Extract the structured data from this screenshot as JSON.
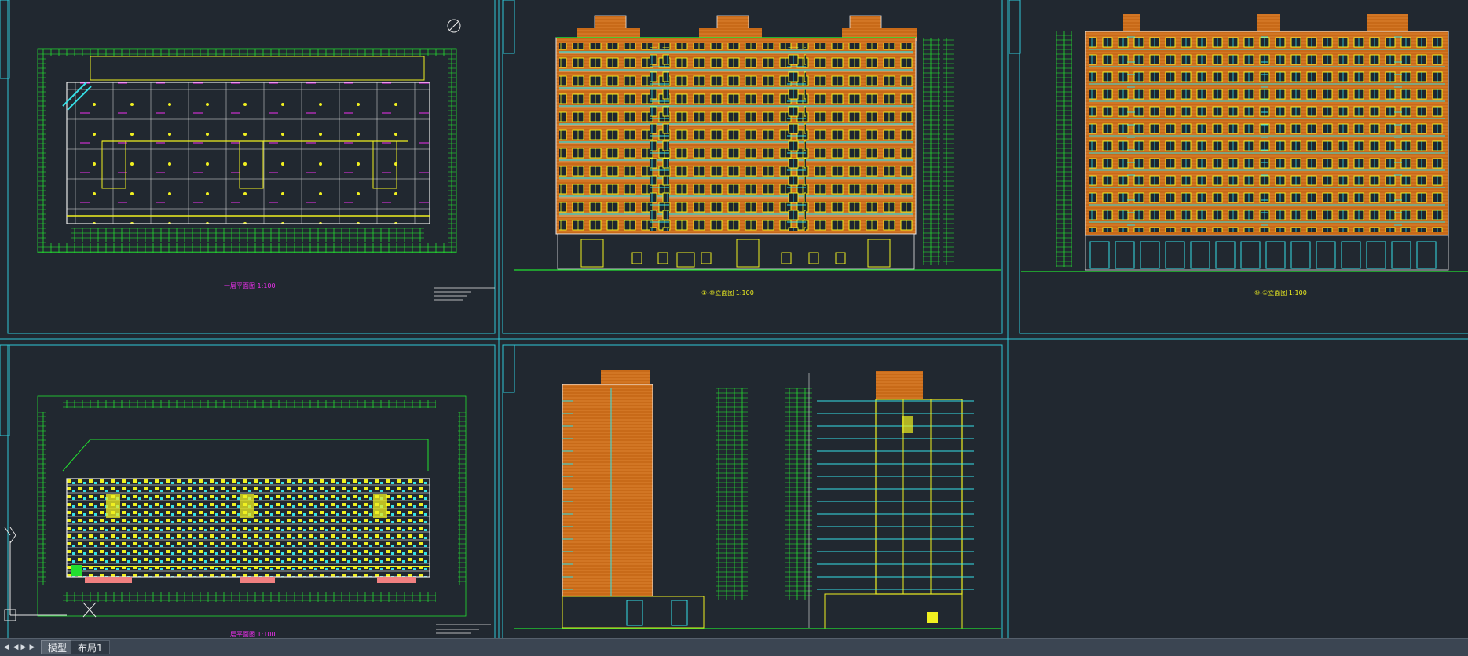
{
  "layout_tabs": {
    "model_label": "模型",
    "layout1_label": "布局1"
  },
  "drawings": {
    "plan_1_title": "一层平面图 1:100",
    "plan_2_title": "二层平面图 1:100",
    "elevation_1_title": "①-⑩立面图 1:100",
    "elevation_2_title": "⑩-①立面图 1:100"
  },
  "colors": {
    "background": "#212830",
    "frame": "#2ec8d8",
    "green": "#22e030",
    "yellow": "#f0f020",
    "orange": "#d4781c",
    "cyan": "#35e0e8",
    "magenta": "#f030f0",
    "white": "#e8e8e8",
    "tabbar": "#3b4552"
  },
  "icons": {
    "north": "north-arrow-icon",
    "ucs": "ucs-axis-icon",
    "prev": "nav-prev-icon",
    "next": "nav-next-icon",
    "last": "nav-last-icon",
    "first": "nav-first-icon"
  }
}
